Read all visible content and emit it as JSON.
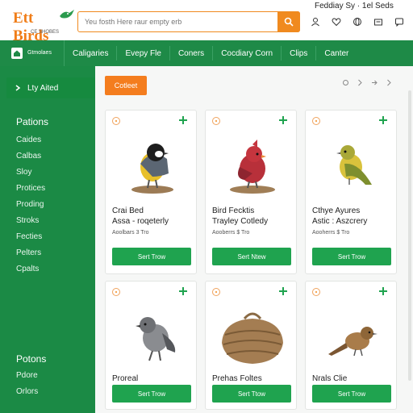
{
  "header": {
    "logo_title": "Ett Birds",
    "logo_subtitle": "CE SHOBES",
    "search_placeholder": "Yeu fosth Here raur empty erb",
    "top_right_text": "Feddiay Sy · 1el Seds"
  },
  "nav": {
    "home_label_line1": "Gtmolaes",
    "home_label_line2": "",
    "items": [
      "Caligaries",
      "Evepy Fle",
      "Coners",
      "Cocdiary Corn",
      "Clips",
      "Canter"
    ]
  },
  "sidebar": {
    "active_label": "Lty Aited",
    "heading_1": "Pations",
    "items": [
      "Caides",
      "Calbas",
      "Sloy",
      "Protices",
      "Proding",
      "Stroks",
      "Fecties",
      "Pelters",
      "Cpalts"
    ],
    "heading_2": "Potons",
    "items_2": [
      "Pdore",
      "Orlors"
    ]
  },
  "main": {
    "action_button": "Cotleet",
    "cards": [
      {
        "title_1": "Crai Bed",
        "title_2": "Assa - roqeterly",
        "meta": "Aoolbars 3 Tro",
        "button": "Sert Trow",
        "image": "chickadee-bird"
      },
      {
        "title_1": "Bird Fecktis",
        "title_2": "Trayley Cotledy",
        "meta": "Aooberrs $ Tro",
        "button": "Sert Ntew",
        "image": "red-cardinal-bird"
      },
      {
        "title_1": "Cthye Ayures",
        "title_2": "Astic : Aszcrery",
        "meta": "Aooherrs $ Tro",
        "button": "Sert Trow",
        "image": "yellow-green-warbler"
      },
      {
        "title_1": "Proreal",
        "title_2": "",
        "meta": "",
        "button": "Sert Trow",
        "image": "grey-bird"
      },
      {
        "title_1": "Prehas Foltes",
        "title_2": "",
        "meta": "",
        "button": "Sert Ttow",
        "image": "nest-basket"
      },
      {
        "title_1": "Nrals Clie",
        "title_2": "",
        "meta": "",
        "button": "Sert Trow",
        "image": "brown-wren-bird"
      }
    ]
  },
  "colors": {
    "brand_green": "#1e8a47",
    "button_green": "#1fa34f",
    "accent_orange": "#f08a1f"
  }
}
